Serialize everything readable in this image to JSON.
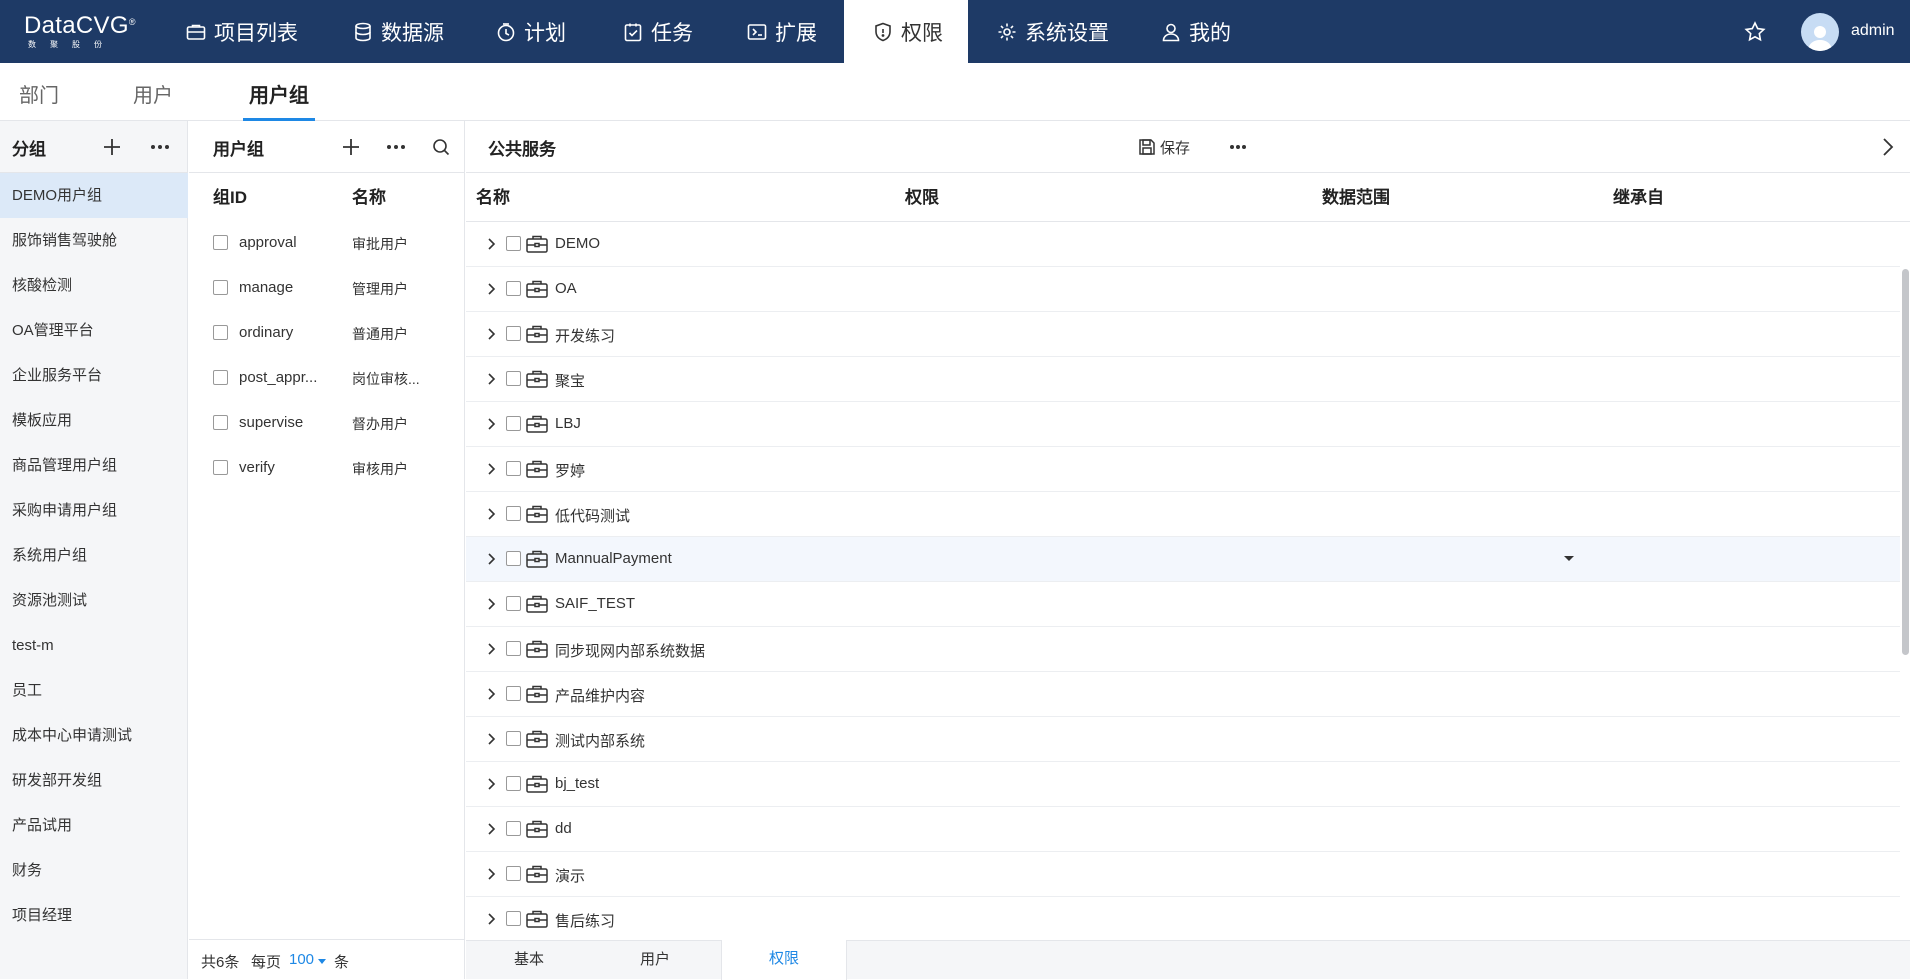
{
  "brand": {
    "name": "DataCVG",
    "reg": "®",
    "tagline": "数聚股份"
  },
  "nav": {
    "items": [
      {
        "label": "项目列表",
        "icon": "folder-icon"
      },
      {
        "label": "数据源",
        "icon": "database-icon"
      },
      {
        "label": "计划",
        "icon": "clock-icon"
      },
      {
        "label": "任务",
        "icon": "task-icon"
      },
      {
        "label": "扩展",
        "icon": "extension-icon"
      },
      {
        "label": "权限",
        "icon": "shield-icon"
      },
      {
        "label": "系统设置",
        "icon": "gear-icon"
      },
      {
        "label": "我的",
        "icon": "user-icon"
      }
    ],
    "active": "权限",
    "user": "admin"
  },
  "subtabs": [
    "部门",
    "用户",
    "用户组"
  ],
  "active_subtab": "用户组",
  "groups_panel": {
    "title": "分组",
    "items": [
      "DEMO用户组",
      "服饰销售驾驶舱",
      "核酸检测",
      "OA管理平台",
      "企业服务平台",
      "模板应用",
      "商品管理用户组",
      "采购申请用户组",
      "系统用户组",
      "资源池测试",
      "test-m",
      "员工",
      "成本中心申请测试",
      "研发部开发组",
      "产品试用",
      "财务",
      "项目经理"
    ],
    "selected": "DEMO用户组"
  },
  "user_groups": {
    "title": "用户组",
    "columns": [
      "组ID",
      "名称"
    ],
    "rows": [
      {
        "id": "approval",
        "name": "审批用户"
      },
      {
        "id": "manage",
        "name": "管理用户"
      },
      {
        "id": "ordinary",
        "name": "普通用户"
      },
      {
        "id": "post_appr...",
        "name": "岗位审核..."
      },
      {
        "id": "supervise",
        "name": "督办用户"
      },
      {
        "id": "verify",
        "name": "审核用户"
      }
    ],
    "pager": {
      "total": "共6条",
      "per_page_label": "每页",
      "page_size": "100",
      "unit": "条"
    }
  },
  "permissions": {
    "title": "公共服务",
    "save_label": "保存",
    "columns": [
      "名称",
      "权限",
      "数据范围",
      "继承自"
    ],
    "rows": [
      "DEMO",
      "OA",
      "开发练习",
      "聚宝",
      "LBJ",
      "罗婷",
      "低代码测试",
      "MannualPayment",
      "SAIF_TEST",
      "同步现网内部系统数据",
      "产品维护内容",
      "测试内部系统",
      "bj_test",
      "dd",
      "演示",
      "售后练习"
    ],
    "hover_row": "MannualPayment"
  },
  "bottom_tabs": [
    "基本",
    "用户",
    "权限"
  ],
  "active_bottom_tab": "权限",
  "colors": {
    "nav_bg": "#1e3a66",
    "accent": "#1e88e5",
    "selected_bg": "#dce9f8"
  }
}
